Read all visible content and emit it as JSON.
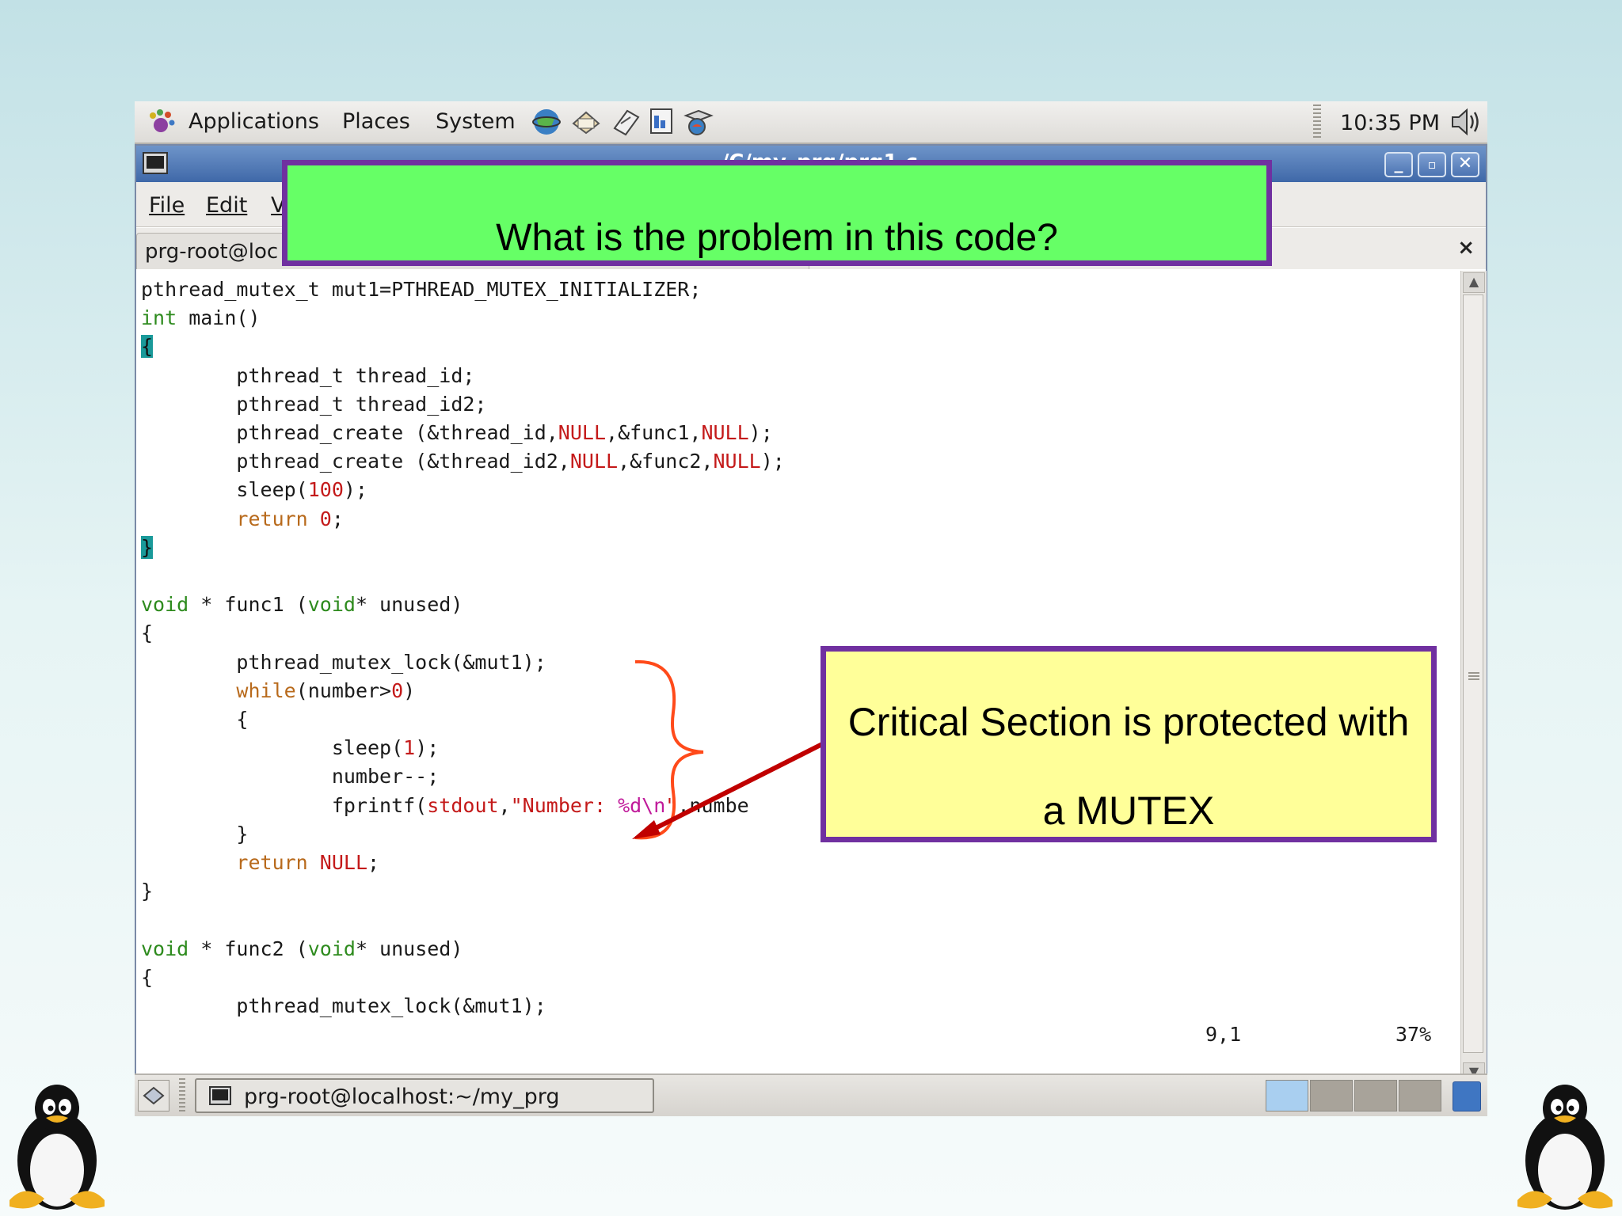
{
  "top_panel": {
    "applications": "Applications",
    "places": "Places",
    "system": "System",
    "clock": "10:35 PM",
    "launcher_icons": [
      "web-browser-icon",
      "email-icon",
      "notes-icon",
      "presentation-icon",
      "help-icon"
    ]
  },
  "window": {
    "title": "~/C/my_prg/prg1.c",
    "menubar": {
      "file": "File",
      "edit": "Edit",
      "view": "V"
    },
    "tab": {
      "label": "prg-root@loc",
      "close": "×"
    }
  },
  "code": [
    [
      [
        "pthread_mutex_t mut1=PTHREAD_MUTEX_INITIALIZER;",
        ""
      ]
    ],
    [
      [
        "int",
        "kw"
      ],
      [
        " main()",
        ""
      ]
    ],
    [
      [
        "{",
        "cur"
      ]
    ],
    [
      [
        "        pthread_t thread_id;",
        ""
      ]
    ],
    [
      [
        "        pthread_t thread_id2;",
        ""
      ]
    ],
    [
      [
        "        pthread_create (&thread_id,",
        ""
      ],
      [
        "NULL",
        "red"
      ],
      [
        ",&func1,",
        ""
      ],
      [
        "NULL",
        "red"
      ],
      [
        ");",
        ""
      ]
    ],
    [
      [
        "        pthread_create (&thread_id2,",
        ""
      ],
      [
        "NULL",
        "red"
      ],
      [
        ",&func2,",
        ""
      ],
      [
        "NULL",
        "red"
      ],
      [
        ");",
        ""
      ]
    ],
    [
      [
        "        sleep(",
        ""
      ],
      [
        "100",
        "red"
      ],
      [
        ");",
        ""
      ]
    ],
    [
      [
        "        ",
        ""
      ],
      [
        "return",
        "ret"
      ],
      [
        " ",
        ""
      ],
      [
        "0",
        "red"
      ],
      [
        ";",
        ""
      ]
    ],
    [
      [
        "}",
        "cur"
      ]
    ],
    [
      [
        "",
        ""
      ]
    ],
    [
      [
        "void",
        "kw"
      ],
      [
        " * func1 (",
        ""
      ],
      [
        "void",
        "kw"
      ],
      [
        "* unused)",
        ""
      ]
    ],
    [
      [
        "{",
        ""
      ]
    ],
    [
      [
        "        pthread_mutex_lock(&mut1);",
        ""
      ]
    ],
    [
      [
        "        ",
        ""
      ],
      [
        "while",
        "ret"
      ],
      [
        "(number>",
        ""
      ],
      [
        "0",
        "red"
      ],
      [
        ")",
        ""
      ]
    ],
    [
      [
        "        {",
        ""
      ]
    ],
    [
      [
        "                sleep(",
        ""
      ],
      [
        "1",
        "red"
      ],
      [
        ");",
        ""
      ]
    ],
    [
      [
        "                number--;",
        ""
      ]
    ],
    [
      [
        "                fprintf(",
        ""
      ],
      [
        "stdout",
        "red"
      ],
      [
        ",",
        ""
      ],
      [
        "\"Number: ",
        "red"
      ],
      [
        "%d\\n",
        "mag"
      ],
      [
        "\"",
        "red"
      ],
      [
        ",numbe",
        ""
      ]
    ],
    [
      [
        "        }",
        ""
      ]
    ],
    [
      [
        "        ",
        ""
      ],
      [
        "return",
        "ret"
      ],
      [
        " ",
        ""
      ],
      [
        "NULL",
        "red"
      ],
      [
        ";",
        ""
      ]
    ],
    [
      [
        "}",
        ""
      ]
    ],
    [
      [
        "",
        ""
      ]
    ],
    [
      [
        "void",
        "kw"
      ],
      [
        " * func2 (",
        ""
      ],
      [
        "void",
        "kw"
      ],
      [
        "* unused)",
        ""
      ]
    ],
    [
      [
        "{",
        ""
      ]
    ],
    [
      [
        "        pthread_mutex_lock(&mut1);",
        ""
      ]
    ]
  ],
  "status": {
    "position": "9,1",
    "percent": "37%"
  },
  "bottom_panel": {
    "task_label": "prg-root@localhost:~/my_prg",
    "workspaces": 4,
    "active_workspace": 1
  },
  "callouts": {
    "question": "What is the problem in this code?",
    "critical_line1": "Critical Section is protected with",
    "critical_line2": "a MUTEX"
  },
  "colors": {
    "question_bg": "#66ff66",
    "critical_bg": "#ffff99",
    "callout_border": "#7030a0",
    "brace": "#ff4a1a",
    "arrow": "#c00000"
  }
}
